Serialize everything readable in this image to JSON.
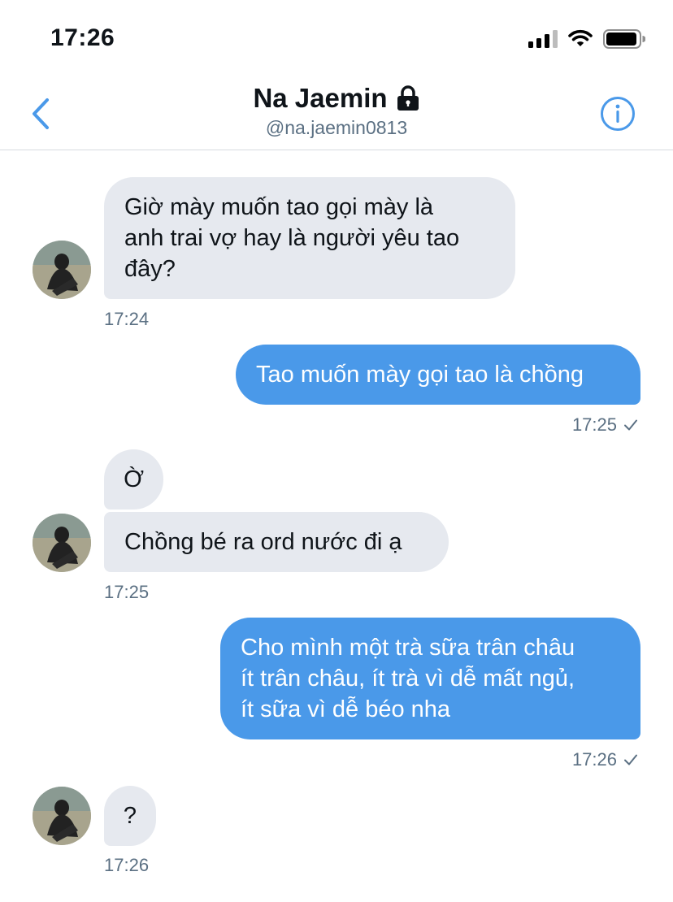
{
  "status_bar": {
    "time": "17:26"
  },
  "header": {
    "title": "Na Jaemin",
    "handle": "@na.jaemin0813"
  },
  "colors": {
    "accent": "#4a99e9",
    "received_bubble": "#e6e9ef",
    "meta_text": "#5b7083"
  },
  "messages": [
    {
      "direction": "received",
      "text": "Giờ mày muốn tao gọi mày là\nanh trai vợ hay là người yêu tao\nđây?",
      "time": "17:24"
    },
    {
      "direction": "sent",
      "text": "Tao muốn mày gọi tao là chồng",
      "time": "17:25",
      "status_icon": "check-icon"
    },
    {
      "direction": "received",
      "text": "Ờ"
    },
    {
      "direction": "received",
      "text": "Chồng bé ra ord nước đi ạ",
      "time": "17:25"
    },
    {
      "direction": "sent",
      "text": "Cho mình một trà sữa trân châu\nít trân châu, ít trà vì dễ mất ngủ,\nít sữa vì dễ béo nha",
      "time": "17:26",
      "status_icon": "check-icon"
    },
    {
      "direction": "received",
      "text": "?",
      "time": "17:26"
    }
  ]
}
